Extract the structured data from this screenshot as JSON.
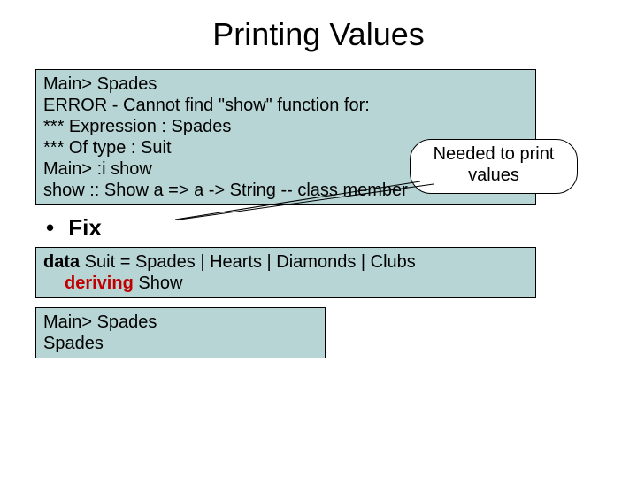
{
  "title": "Printing Values",
  "box1": {
    "line1": "Main> Spades",
    "line2": "ERROR - Cannot find \"show\" function for:",
    "line3": "*** Expression : Spades",
    "line4": "*** Of type    : Suit",
    "line5": "",
    "line6": "Main> :i show",
    "line7": "show :: Show a => a -> String  -- class member"
  },
  "callout": {
    "line1": "Needed to print",
    "line2": "values"
  },
  "bullet": "Fix",
  "box2": {
    "kw1": "data",
    "rest1": " Suit = Spades | Hearts | Diamonds | Clubs",
    "kw2": "deriving",
    "rest2": " Show"
  },
  "box3": {
    "line1": "Main> Spades",
    "line2": "Spades"
  }
}
